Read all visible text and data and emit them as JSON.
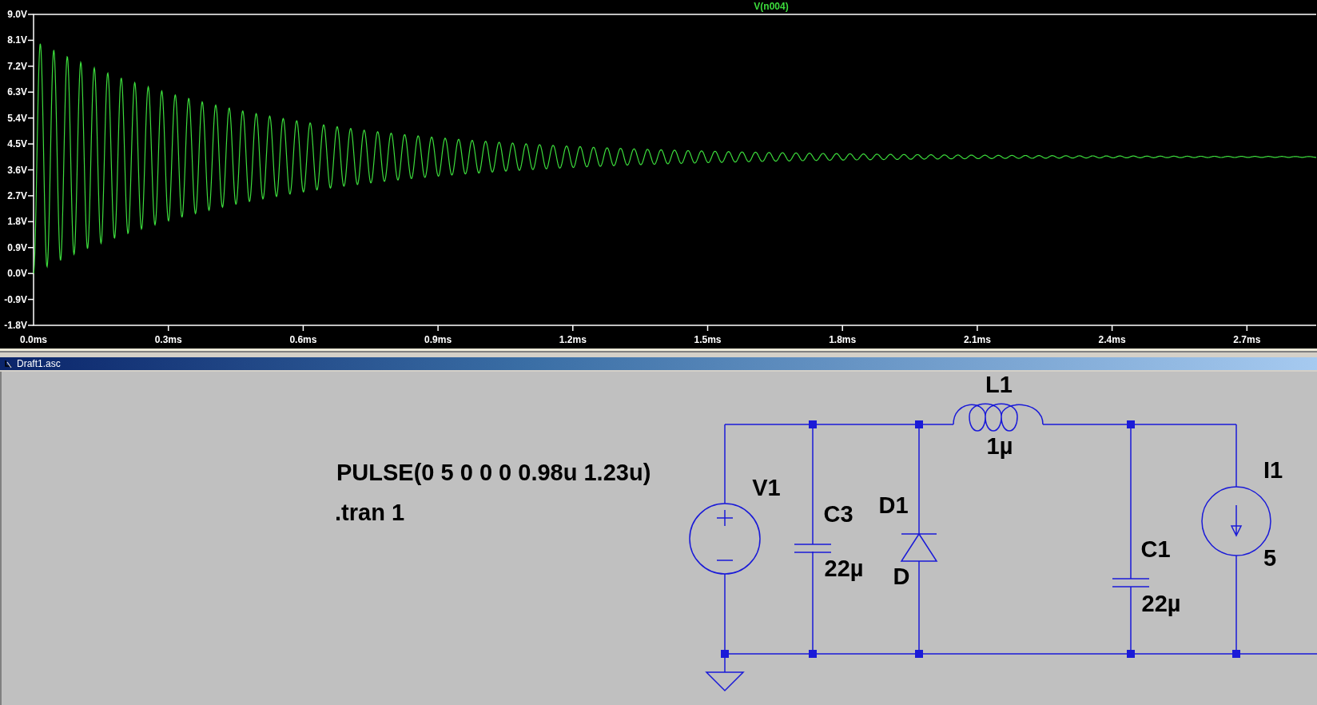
{
  "plot": {
    "traces": [
      {
        "label": "V(n004)"
      }
    ],
    "yticks": [
      "9.0V",
      "8.1V",
      "7.2V",
      "6.3V",
      "5.4V",
      "4.5V",
      "3.6V",
      "2.7V",
      "1.8V",
      "0.9V",
      "0.0V",
      "-0.9V",
      "-1.8V"
    ],
    "xticks": [
      "0.0ms",
      "0.3ms",
      "0.6ms",
      "0.9ms",
      "1.2ms",
      "1.5ms",
      "1.8ms",
      "2.1ms",
      "2.4ms",
      "2.7ms"
    ]
  },
  "schematic_window": {
    "title": "Draft1.asc"
  },
  "schematic": {
    "directives": [
      "PULSE(0 5 0 0 0 0.98u 1.23u)",
      ".tran 1"
    ],
    "components": [
      {
        "kind": "voltage_source",
        "name": "V1"
      },
      {
        "kind": "capacitor",
        "name": "C3",
        "value": "22µ"
      },
      {
        "kind": "diode",
        "name": "D1",
        "value": "D"
      },
      {
        "kind": "inductor",
        "name": "L1",
        "value": "1µ"
      },
      {
        "kind": "capacitor",
        "name": "C1",
        "value": "22µ"
      },
      {
        "kind": "current_source",
        "name": "I1",
        "value": "5"
      }
    ]
  }
}
